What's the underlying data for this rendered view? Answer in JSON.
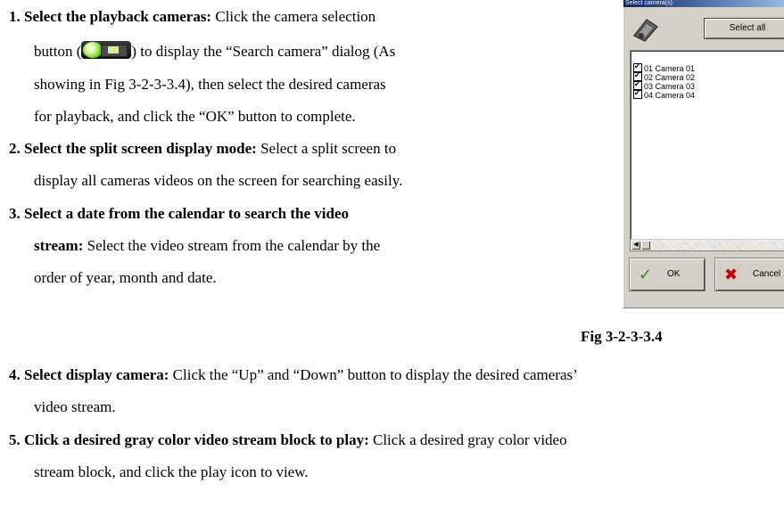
{
  "steps": [
    {
      "num": "1.",
      "lead": "Select the playback cameras:",
      "lines": [
        "Click the camera selection",
        "button (",
        ") to display the “Search camera” dialog (As",
        "showing in Fig 3-2-3-3.4), then select the desired cameras",
        "for playback, and click the “OK” button to complete."
      ]
    },
    {
      "num": "2.",
      "lead": "Select the split screen display mode:",
      "lines": [
        "Select a split screen to",
        "display all cameras videos on the screen for searching easily."
      ]
    },
    {
      "num": "3.",
      "lead": "Select a date from the calendar to search the video",
      "lead2": "stream:",
      "lines": [
        "Select the video stream from the calendar by the",
        "order of year, month and date."
      ]
    },
    {
      "num": "4.",
      "lead": "Select display camera:",
      "lines": [
        "Click the “Up” and “Down” button to display the desired cameras’",
        "video stream."
      ]
    },
    {
      "num": "5.",
      "lead": "Click a desired gray color video stream block to play:",
      "lines": [
        "Click a desired gray color video",
        "stream block, and click the play icon to view."
      ]
    }
  ],
  "dialog": {
    "title": "Select camera(s)",
    "select_all": "Select all",
    "cameras": [
      "01 Camera 01",
      "02 Camera 02",
      "03 Camera 03",
      "04 Camera 04"
    ],
    "ok": "OK",
    "cancel": "Cancel"
  },
  "caption": "Fig 3-2-3-3.4",
  "icons": {
    "camera_button": "camera-selection-icon",
    "dialog_camera": "camera-icon",
    "ok": "checkmark-icon",
    "cancel": "x-icon"
  }
}
